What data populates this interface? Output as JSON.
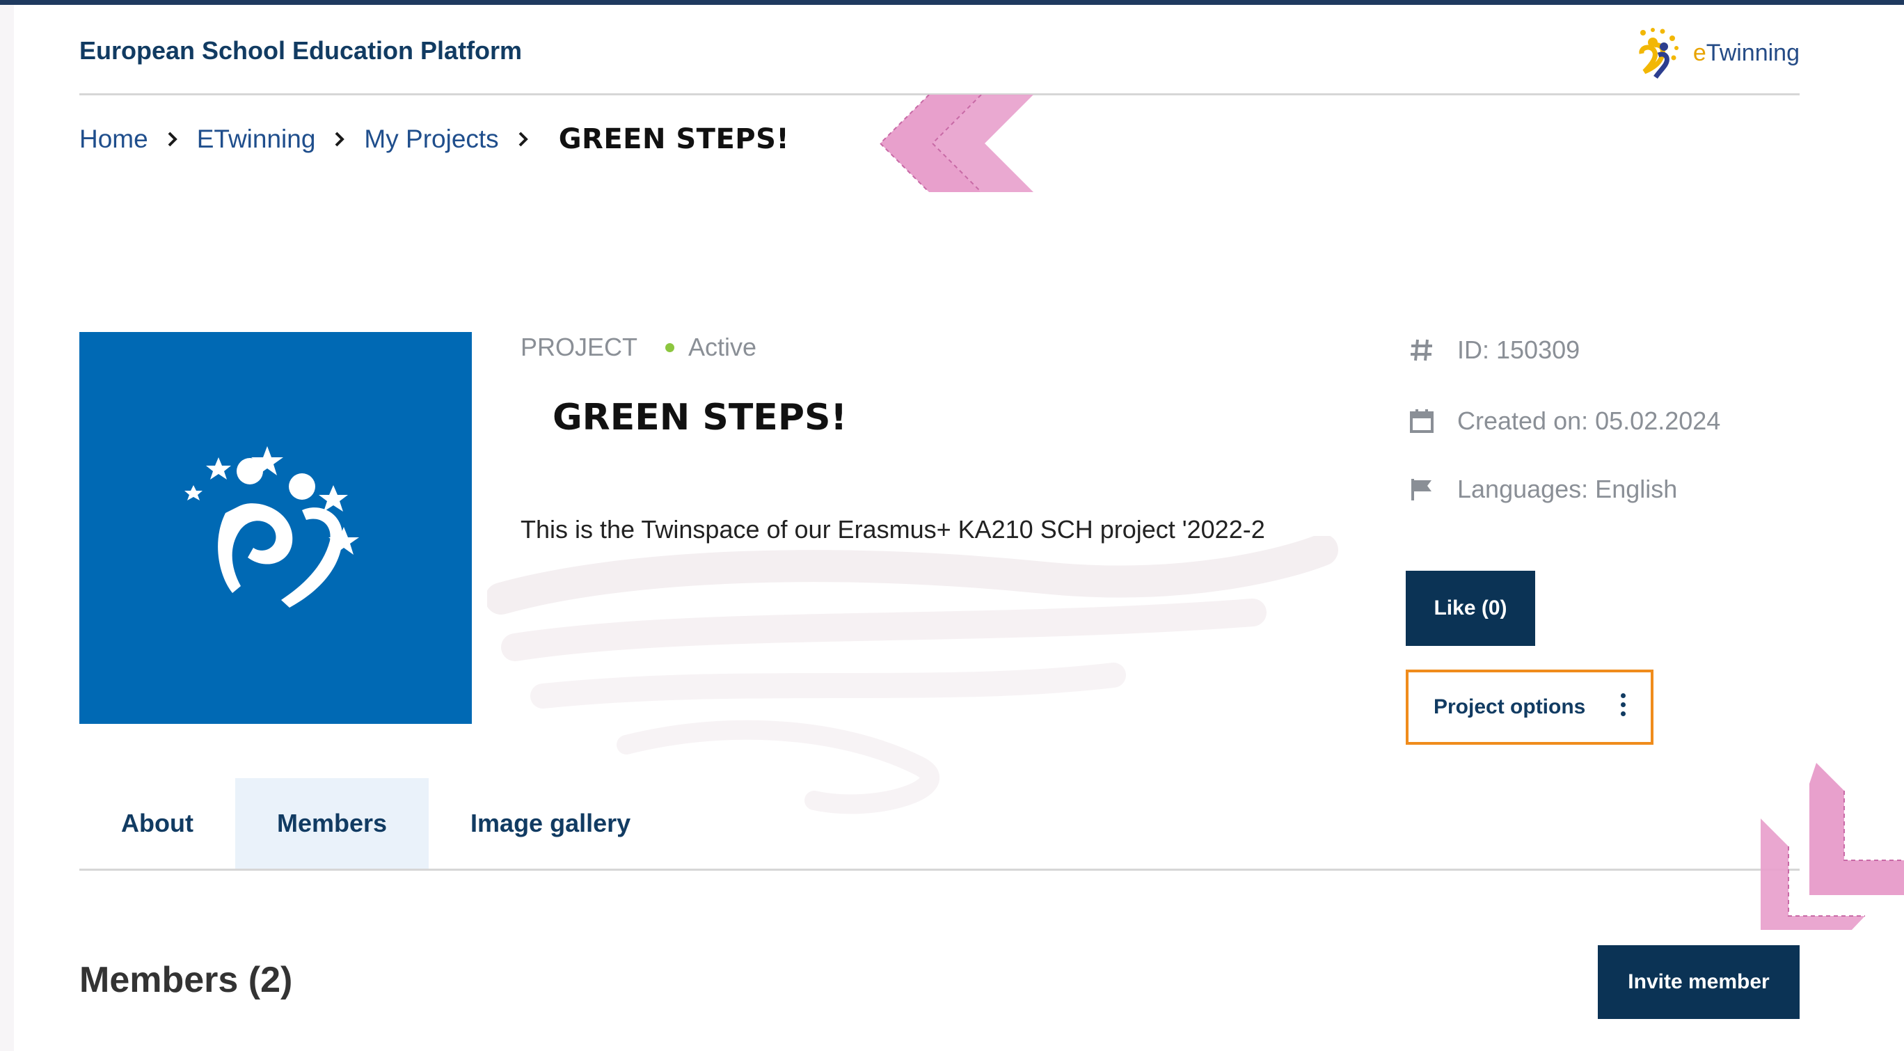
{
  "header": {
    "site_title": "European School Education Platform",
    "logo_text_e": "e",
    "logo_text_rest": "Twinning"
  },
  "breadcrumb": {
    "items": [
      "Home",
      "ETwinning",
      "My Projects"
    ],
    "current": "GREEN STEPS!"
  },
  "project": {
    "kind": "PROJECT",
    "status": "Active",
    "title": "GREEN STEPS!",
    "description": "This is the Twinspace of our Erasmus+ KA210 SCH project '2022-2"
  },
  "info": {
    "id": "ID: 150309",
    "created": "Created on: 05.02.2024",
    "languages": "Languages: English"
  },
  "actions": {
    "like": "Like (0)",
    "project_options": "Project options"
  },
  "tabs": [
    {
      "label": "About",
      "active": false
    },
    {
      "label": "Members",
      "active": true
    },
    {
      "label": "Image gallery",
      "active": false
    }
  ],
  "members": {
    "heading": "Members (2)",
    "invite": "Invite member"
  },
  "colors": {
    "brand_navy": "#0b3355",
    "image_blue": "#0069b4",
    "accent_orange": "#f08c1c",
    "status_green": "#8cc63f",
    "annotation_pink": "#e8a0cc"
  },
  "icons": [
    "hash-icon",
    "calendar-icon",
    "flag-icon",
    "chevron-right-icon",
    "kebab-menu-icon",
    "etwinning-logo",
    "project-logo"
  ]
}
